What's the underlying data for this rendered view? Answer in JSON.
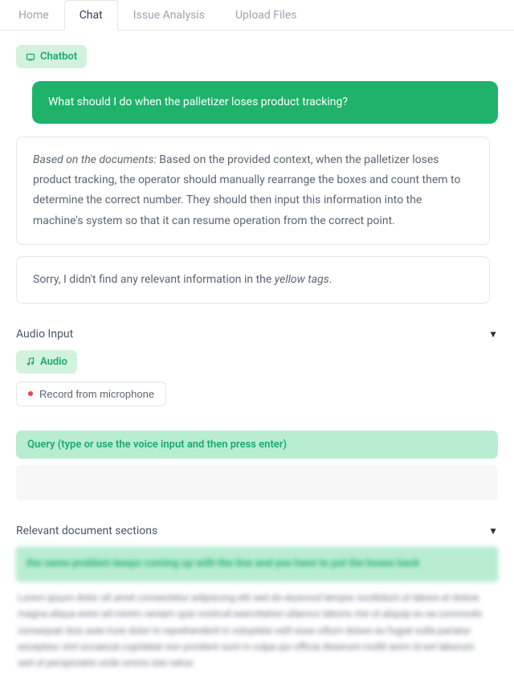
{
  "tabs": {
    "home": "Home",
    "chat": "Chat",
    "issue": "Issue Analysis",
    "upload": "Upload Files"
  },
  "chatbot_label": "Chatbot",
  "messages": {
    "user1": "What should I do when the palletizer loses product tracking?",
    "bot1_prefix": "Based on the documents:",
    "bot1_body": " Based on the provided context, when the palletizer loses product tracking, the operator should manually rearrange the boxes and count them to determine the correct number. They should then input this information into the machine's system so that it can resume operation from the correct point.",
    "bot2_pre": "Sorry, I didn't find any relevant information in the ",
    "bot2_em": "yellow tags",
    "bot2_post": "."
  },
  "audio": {
    "header": "Audio Input",
    "pill": "Audio",
    "record": "Record from microphone"
  },
  "query": {
    "label": "Query (type or use the voice input and then press enter)",
    "value": ""
  },
  "relevant": {
    "header": "Relevant document sections",
    "highlight": "the same problem keeps coming up with the line and you have to put the boxes back",
    "body": "Lorem ipsum dolor sit amet consectetur adipiscing elit sed do eiusmod tempor incididunt ut labore et dolore magna aliqua enim ad minim veniam quis nostrud exercitation ullamco laboris nisi ut aliquip ex ea commodo consequat duis aute irure dolor in reprehenderit in voluptate velit esse cillum dolore eu fugiat nulla pariatur excepteur sint occaecat cupidatat non proident sunt in culpa qui officia deserunt mollit anim id est laborum sed ut perspiciatis unde omnis iste natus"
  }
}
